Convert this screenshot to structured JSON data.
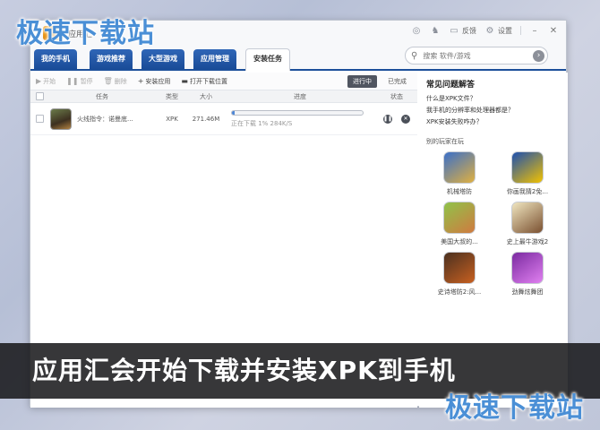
{
  "watermark": "极速下载站",
  "app": {
    "title": "应用汇"
  },
  "titlebar": {
    "feedback": "反馈",
    "settings": "设置"
  },
  "tabs": [
    {
      "label": "我的手机"
    },
    {
      "label": "游戏推荐"
    },
    {
      "label": "大型游戏"
    },
    {
      "label": "应用管理"
    },
    {
      "label": "安装任务"
    }
  ],
  "search": {
    "placeholder": "搜索 软件/游戏"
  },
  "toolbar": {
    "start": "开始",
    "pause": "暂停",
    "delete": "删除",
    "install": "安装应用",
    "open_location": "打开下载位置"
  },
  "filters": {
    "in_progress": "进行中",
    "completed": "已完成"
  },
  "table": {
    "headers": {
      "task": "任务",
      "type": "类型",
      "size": "大小",
      "progress": "进度",
      "status": "状态"
    },
    "rows": [
      {
        "name": "火线指令：诺曼底...",
        "type": "XPK",
        "size": "271.46M",
        "progress": 0.01,
        "status_text": "正在下载 1% 284K/S"
      }
    ]
  },
  "faq": {
    "title": "常见问题解答",
    "links": [
      "什么是XPK文件？",
      "我手机的分辨率和处理器都是？",
      "XPK安装失败咋办？"
    ]
  },
  "players": {
    "title": "别的玩家在玩",
    "apps": [
      {
        "label": "机械塔防",
        "color_a": "#3a6fc9",
        "color_b": "#e0b040"
      },
      {
        "label": "你画我猜2免...",
        "color_a": "#1c4fb0",
        "color_b": "#f2c200"
      },
      {
        "label": "美国大叔的...",
        "color_a": "#8fc34a",
        "color_b": "#d07a40"
      },
      {
        "label": "史上最牛游戏2",
        "color_a": "#f0e6c0",
        "color_b": "#7a5030"
      },
      {
        "label": "史诗塔防2:风...",
        "color_a": "#4a3020",
        "color_b": "#c86020"
      },
      {
        "label": "劲舞炫舞团",
        "color_a": "#7a2aa0",
        "color_b": "#e080f0"
      }
    ]
  },
  "caption": "应用汇会开始下载并安装XPK到手机"
}
